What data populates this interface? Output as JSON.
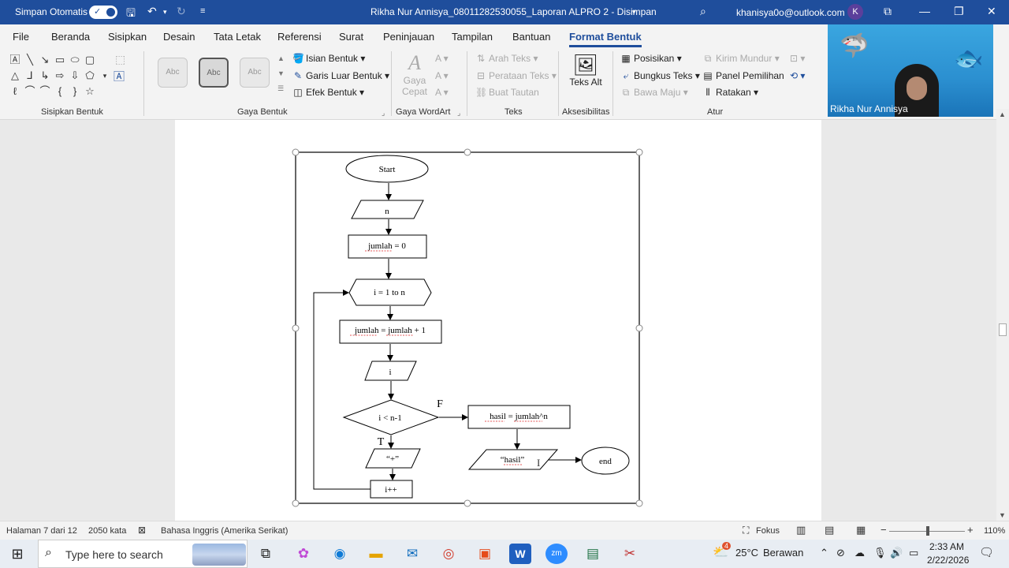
{
  "titlebar": {
    "autosave_label": "Simpan Otomatis",
    "document_title": "Rikha Nur Annisya_08011282530055_Laporan ALPRO 2  -  Disimpan",
    "account_email": "khanisya0o@outlook.com",
    "account_initial": "K"
  },
  "menu": {
    "tabs": [
      "File",
      "Beranda",
      "Sisipkan",
      "Desain",
      "Tata Letak",
      "Referensi",
      "Surat",
      "Peninjauan",
      "Tampilan",
      "Bantuan",
      "Format Bentuk"
    ],
    "active_tab": "Format Bentuk"
  },
  "ribbon": {
    "insert_shapes_label": "Sisipkan Bentuk",
    "shape_styles_label": "Gaya Bentuk",
    "style_sample_text": "Abc",
    "shape_fill": "Isian Bentuk",
    "shape_outline": "Garis Luar Bentuk",
    "shape_effects": "Efek Bentuk",
    "wordart_label": "Gaya WordArt",
    "quick_styles": "Gaya Cepat",
    "text_label": "Teks",
    "text_direction": "Arah Teks",
    "align_text": "Perataan Teks",
    "create_link": "Buat Tautan",
    "alt_text": "Teks Alt",
    "accessibility_label": "Aksesibilitas",
    "position": "Posisikan",
    "wrap_text": "Bungkus Teks",
    "bring_forward": "Bawa Maju",
    "send_backward": "Kirim Mundur",
    "selection_pane": "Panel Pemilihan",
    "align": "Ratakan",
    "arrange_label": "Atur"
  },
  "video": {
    "participant_name": "Rikha Nur Annisya"
  },
  "flowchart": {
    "start": "Start",
    "input_n": "n",
    "init": "jumlah = 0",
    "loop": "i = 1 to n",
    "accumulate": "jumlah = jumlah + 1",
    "output_i": "i",
    "condition": "i < n-1",
    "false_label": "F",
    "true_label": "T",
    "output_plus": "“+”",
    "increment": "i++",
    "compute": "hasil = jumlah^n",
    "output_hasil": "“hasil”",
    "end": "end"
  },
  "status": {
    "page": "Halaman 7 dari 12",
    "words": "2050 kata",
    "language": "Bahasa Inggris (Amerika Serikat)",
    "focus": "Fokus",
    "zoom": "110%"
  },
  "taskbar": {
    "search_placeholder": "Type here to search",
    "weather_temp": "25°C",
    "weather_desc": "Berawan",
    "weather_badge": "4",
    "time": "2:33 AM",
    "date": "2/22/2026"
  },
  "colors": {
    "title_blue": "#1f4e9c",
    "ribbon_bg": "#f3f3f3"
  }
}
